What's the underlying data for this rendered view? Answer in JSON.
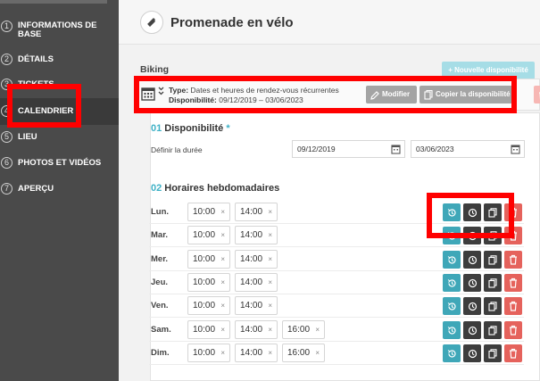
{
  "sidebar": {
    "steps": [
      {
        "num": "1",
        "label": "Informations de base"
      },
      {
        "num": "2",
        "label": "Détails"
      },
      {
        "num": "3",
        "label": "Tickets"
      },
      {
        "num": "4",
        "label": "Calendrier"
      },
      {
        "num": "5",
        "label": "Lieu"
      },
      {
        "num": "6",
        "label": "Photos et vidéos"
      },
      {
        "num": "7",
        "label": "Aperçu"
      }
    ]
  },
  "header": {
    "title": "Promenade en vélo",
    "icon": "ticket-icon"
  },
  "availability": {
    "section_title": "Biking",
    "new_button": "+ Nouvelle disponibilité",
    "type_label": "Type:",
    "type_value": "Dates et heures de rendez-vous récurrentes",
    "dispo_label": "Disponibilité:",
    "dispo_value": "09/12/2019 – 03/06/2023",
    "modify_button": "Modifier",
    "copy_button": "Copier la disponibilité"
  },
  "form": {
    "block1_num": "01",
    "block1_title": "Disponibilité",
    "block1_req": "*",
    "duration_label": "Définir la durée",
    "start_date": "09/12/2019",
    "end_date": "03/06/2023",
    "block2_num": "02",
    "block2_title": "Horaires hebdomadaires",
    "days": [
      {
        "day": "Lun.",
        "times": [
          "10:00",
          "14:00"
        ]
      },
      {
        "day": "Mar.",
        "times": [
          "10:00",
          "14:00"
        ]
      },
      {
        "day": "Mer.",
        "times": [
          "10:00",
          "14:00"
        ]
      },
      {
        "day": "Jeu.",
        "times": [
          "10:00",
          "14:00"
        ]
      },
      {
        "day": "Ven.",
        "times": [
          "10:00",
          "14:00"
        ]
      },
      {
        "day": "Sam.",
        "times": [
          "10:00",
          "14:00",
          "16:00"
        ]
      },
      {
        "day": "Dim.",
        "times": [
          "10:00",
          "14:00",
          "16:00"
        ]
      }
    ],
    "remove_glyph": "×"
  },
  "colors": {
    "accent": "#3fb1c6",
    "teal_button": "#3fa7b8",
    "dark_button": "#3d3d3d",
    "danger": "#e5625c",
    "highlight": "#ff0000"
  }
}
